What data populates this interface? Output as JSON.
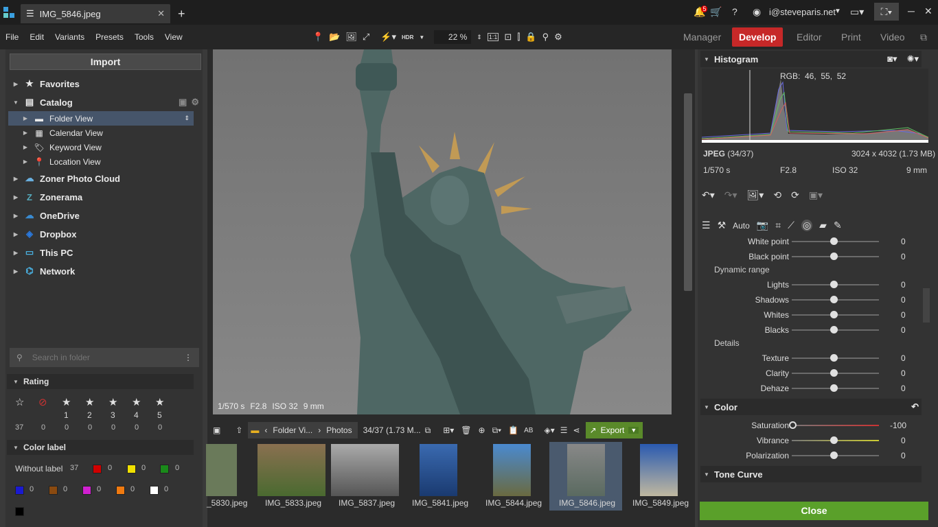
{
  "window": {
    "tab_title": "IMG_5846.jpeg",
    "user": "i@steveparis.net",
    "notifications": "5"
  },
  "menu": [
    "File",
    "Edit",
    "Variants",
    "Presets",
    "Tools",
    "View"
  ],
  "toolbar": {
    "hdr_label": "HDR",
    "zoom": "22 %",
    "one_to_one": "1:1"
  },
  "modes": {
    "manager": "Manager",
    "develop": "Develop",
    "editor": "Editor",
    "print": "Print",
    "video": "Video"
  },
  "left": {
    "import": "Import",
    "tree": {
      "favorites": "Favorites",
      "catalog": "Catalog",
      "folder_view": "Folder View",
      "calendar_view": "Calendar View",
      "keyword_view": "Keyword View",
      "location_view": "Location View",
      "zoner_cloud": "Zoner Photo Cloud",
      "zonerama": "Zonerama",
      "onedrive": "OneDrive",
      "dropbox": "Dropbox",
      "this_pc": "This PC",
      "network": "Network"
    },
    "search_placeholder": "Search in folder",
    "rating": {
      "title": "Rating",
      "labels": [
        "",
        "",
        "1",
        "2",
        "3",
        "4",
        "5"
      ],
      "counts": [
        "37",
        "0",
        "0",
        "0",
        "0",
        "0",
        "0"
      ]
    },
    "color_label": {
      "title": "Color label",
      "without": "Without label",
      "without_count": "37",
      "colors": [
        "#d00000",
        "#f0e000",
        "#1a8a1a",
        "#1a1ad0",
        "#8a4a10",
        "#d020d0",
        "#f07a10",
        "#ffffff",
        "#000000"
      ],
      "counts": [
        "0",
        "0",
        "0",
        "0",
        "0",
        "0",
        "0",
        "0",
        ""
      ]
    }
  },
  "photo": {
    "shutter": "1/570 s",
    "aperture": "F2.8",
    "iso": "ISO 32",
    "focal": "9 mm"
  },
  "filmbar": {
    "breadcrumb": [
      "Folder Vi...",
      "Photos"
    ],
    "count": "34/37 (1.73 M...",
    "export": "Export"
  },
  "thumbnails": [
    "_5830.jpeg",
    "IMG_5833.jpeg",
    "IMG_5837.jpeg",
    "IMG_5841.jpeg",
    "IMG_5844.jpeg",
    "IMG_5846.jpeg",
    "IMG_5849.jpeg"
  ],
  "right": {
    "histogram_title": "Histogram",
    "rgb": "RGB:  46,  55,  52",
    "format": "JPEG",
    "format_count": "(34/37)",
    "dims": "3024 x 4032 (1.73 MB)",
    "shutter": "1/570 s",
    "aperture": "F2.8",
    "iso": "ISO 32",
    "focal": "9 mm",
    "auto": "Auto",
    "sliders_top": [
      {
        "label": "White point",
        "value": "0"
      },
      {
        "label": "Black point",
        "value": "0"
      }
    ],
    "dynamic_range": "Dynamic range",
    "sliders_dr": [
      {
        "label": "Lights",
        "value": "0"
      },
      {
        "label": "Shadows",
        "value": "0"
      },
      {
        "label": "Whites",
        "value": "0"
      },
      {
        "label": "Blacks",
        "value": "0"
      }
    ],
    "details": "Details",
    "sliders_det": [
      {
        "label": "Texture",
        "value": "0"
      },
      {
        "label": "Clarity",
        "value": "0"
      },
      {
        "label": "Dehaze",
        "value": "0"
      }
    ],
    "color": "Color",
    "sliders_col": [
      {
        "label": "Saturation",
        "value": "-100"
      },
      {
        "label": "Vibrance",
        "value": "0"
      },
      {
        "label": "Polarization",
        "value": "0"
      }
    ],
    "tone_curve": "Tone Curve",
    "close": "Close"
  }
}
